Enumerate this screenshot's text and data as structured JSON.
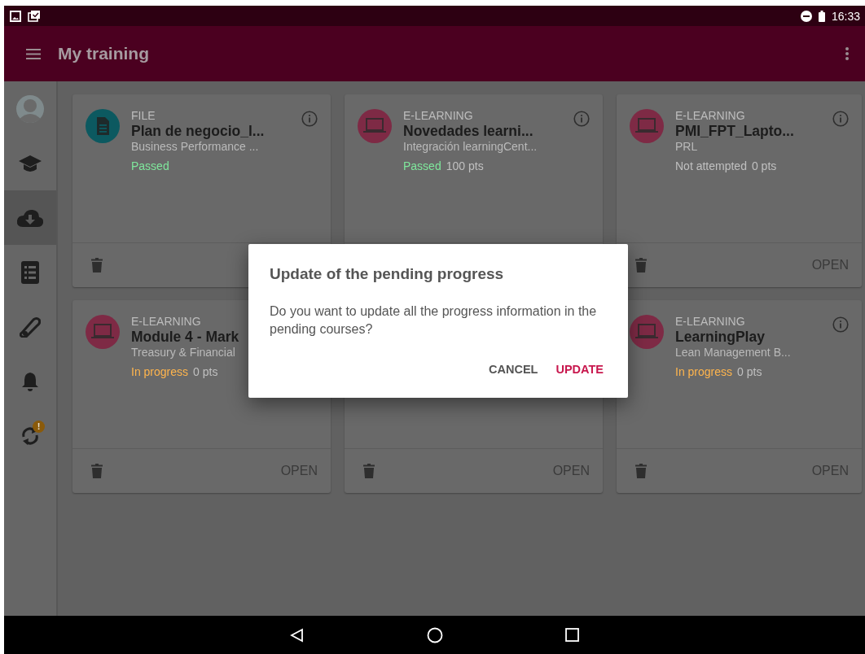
{
  "status_bar": {
    "time": "16:33"
  },
  "app_bar": {
    "title": "My training"
  },
  "sidebar": {
    "items": [
      {
        "kind": "profile",
        "selected": false
      },
      {
        "kind": "courses",
        "selected": false
      },
      {
        "kind": "downloads",
        "selected": true
      },
      {
        "kind": "list",
        "selected": false
      },
      {
        "kind": "certificates",
        "selected": false
      },
      {
        "kind": "notifications",
        "selected": false
      },
      {
        "kind": "sync",
        "selected": false,
        "badge": "!"
      }
    ]
  },
  "cards": [
    {
      "kind": "file",
      "type": "FILE",
      "title": "Plan de negocio_l...",
      "subtitle": "Business Performance ...",
      "status": {
        "kind": "passed",
        "text": "Passed"
      },
      "info_button": true,
      "delete_button": true
    },
    {
      "kind": "elearning",
      "type": "E-LEARNING",
      "title": "Novedades learni...",
      "subtitle": "Integración learningCent...",
      "status": {
        "kind": "passed",
        "text": "Passed"
      },
      "points": "100 pts",
      "info_button": true,
      "delete_button": false
    },
    {
      "kind": "elearning",
      "type": "E-LEARNING",
      "title": "PMI_FPT_Lapto...",
      "subtitle": "PRL",
      "status": {
        "kind": "not_attempted",
        "text": "Not attempted"
      },
      "points": "0 pts",
      "info_button": true,
      "delete_button": true,
      "open": "OPEN"
    },
    {
      "kind": "elearning",
      "type": "E-LEARNING",
      "title": "Module 4 - Mark",
      "subtitle": "Treasury & Financial",
      "status": {
        "kind": "in_progress",
        "text": "In progress"
      },
      "points": "0 pts",
      "info_button": false,
      "delete_button": true,
      "open": "OPEN"
    },
    {
      "info_button": false,
      "delete_button": true,
      "open": "OPEN"
    },
    {
      "kind": "elearning",
      "type": "E-LEARNING",
      "title": "LearningPlay",
      "subtitle": "Lean Management B...",
      "status": {
        "kind": "in_progress",
        "text": "In progress"
      },
      "points": "0 pts",
      "info_button": true,
      "delete_button": true,
      "open": "OPEN"
    }
  ],
  "dialog": {
    "title": "Update of the pending progress",
    "message": "Do you want to update all the progress information in the pending courses?",
    "buttons": [
      {
        "label": "CANCEL",
        "kind": "secondary"
      },
      {
        "label": "UPDATE",
        "kind": "primary"
      }
    ]
  }
}
